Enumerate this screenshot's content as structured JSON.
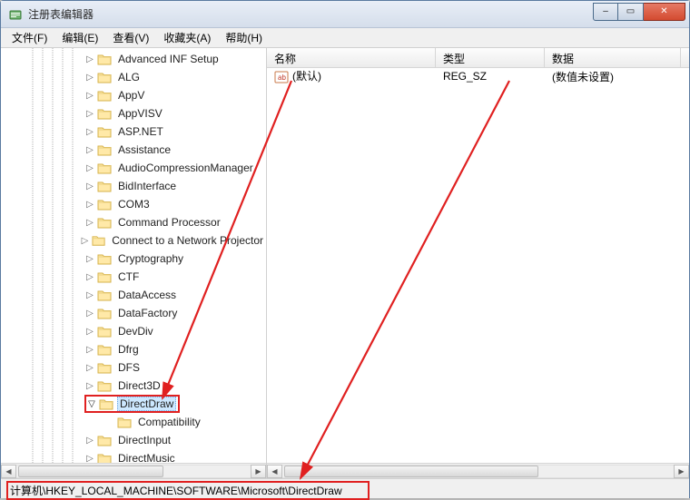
{
  "window": {
    "title": "注册表编辑器"
  },
  "winbtns": {
    "min": "–",
    "max": "▭",
    "close": "✕"
  },
  "menu": {
    "file": "文件(F)",
    "edit": "编辑(E)",
    "view": "查看(V)",
    "favorites": "收藏夹(A)",
    "help": "帮助(H)"
  },
  "tree": {
    "base_indent": 92,
    "items": [
      {
        "label": "Advanced INF Setup",
        "expand": "r"
      },
      {
        "label": "ALG",
        "expand": "r"
      },
      {
        "label": "AppV",
        "expand": "r"
      },
      {
        "label": "AppVISV",
        "expand": "r"
      },
      {
        "label": "ASP.NET",
        "expand": "r"
      },
      {
        "label": "Assistance",
        "expand": "r"
      },
      {
        "label": "AudioCompressionManager",
        "expand": "r"
      },
      {
        "label": "BidInterface",
        "expand": "r"
      },
      {
        "label": "COM3",
        "expand": "r"
      },
      {
        "label": "Command Processor",
        "expand": "r"
      },
      {
        "label": "Connect to a Network Projector",
        "expand": "r"
      },
      {
        "label": "Cryptography",
        "expand": "r"
      },
      {
        "label": "CTF",
        "expand": "r"
      },
      {
        "label": "DataAccess",
        "expand": "r"
      },
      {
        "label": "DataFactory",
        "expand": "r"
      },
      {
        "label": "DevDiv",
        "expand": "r"
      },
      {
        "label": "Dfrg",
        "expand": "r"
      },
      {
        "label": "DFS",
        "expand": "r"
      },
      {
        "label": "Direct3D",
        "expand": "r"
      },
      {
        "label": "DirectDraw",
        "expand": "d",
        "selected": true,
        "redbox": true
      },
      {
        "label": "Compatibility",
        "expand": "",
        "child": true
      },
      {
        "label": "DirectInput",
        "expand": "r"
      },
      {
        "label": "DirectMusic",
        "expand": "r"
      }
    ]
  },
  "list": {
    "cols": {
      "name": "名称",
      "type": "类型",
      "data": "数据"
    },
    "widths": {
      "name": 186,
      "type": 120,
      "data": 150
    },
    "rows": [
      {
        "name": "(默认)",
        "type": "REG_SZ",
        "data": "(数值未设置)"
      }
    ]
  },
  "scroll": {
    "left": "◀",
    "right": "▶"
  },
  "status": {
    "path": "计算机\\HKEY_LOCAL_MACHINE\\SOFTWARE\\Microsoft\\DirectDraw"
  },
  "icons": {
    "folder": "folder-icon",
    "reg_sz": "string-value-icon"
  },
  "annotations": {
    "arrow_color": "#e02020"
  }
}
